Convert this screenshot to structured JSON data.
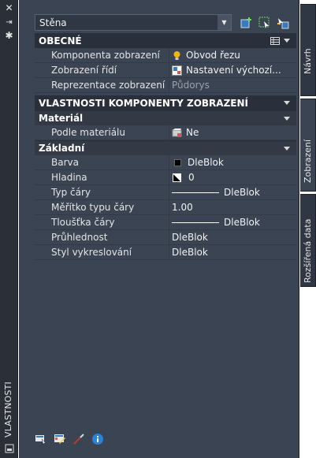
{
  "palette": {
    "vertical_title": "VLASTNOSTI"
  },
  "dropdown": {
    "selected": "Stěna"
  },
  "categories": {
    "general": "OBECNÉ",
    "display_component": "VLASTNOSTI KOMPONENTY ZOBRAZENÍ",
    "material": "Materiál",
    "basic": "Základní"
  },
  "general_rows": [
    {
      "name": "Komponenta zobrazení",
      "value": "Obvod řezu"
    },
    {
      "name": "Zobrazení řídí",
      "value": "Nastavení výchozí..."
    },
    {
      "name": "Reprezentace zobrazení",
      "value": "Půdorys"
    }
  ],
  "material_rows": [
    {
      "name": "Podle materiálu",
      "value": "Ne"
    }
  ],
  "basic_rows": [
    {
      "name": "Barva",
      "value": "DleBlok"
    },
    {
      "name": "Hladina",
      "value": "0"
    },
    {
      "name": "Typ čáry",
      "value": "DleBlok"
    },
    {
      "name": "Měřítko typu čáry",
      "value": "1.00"
    },
    {
      "name": "Tloušťka čáry",
      "value": "DleBlok"
    },
    {
      "name": "Průhlednost",
      "value": "DleBlok"
    },
    {
      "name": "Styl vykreslování",
      "value": "DleBlok"
    }
  ],
  "tabs": [
    "Návrh",
    "Zobrazení",
    "Rozšířená data"
  ],
  "colors": {
    "panel": "#3b4453",
    "category_dark": "#2a303b",
    "text": "#e4e4e4"
  }
}
